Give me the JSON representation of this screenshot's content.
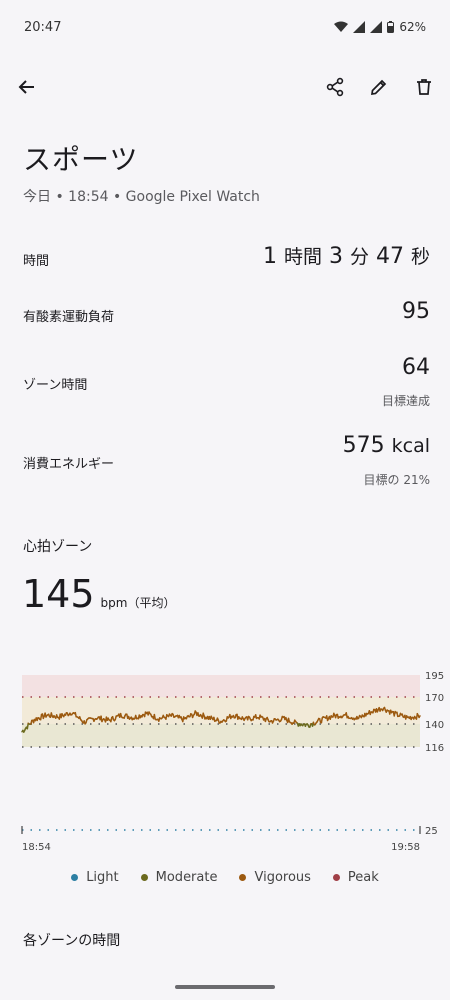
{
  "status": {
    "time": "20:47",
    "battery": "62%"
  },
  "workout": {
    "title": "スポーツ",
    "subtitle": "今日 • 18:54 • Google Pixel Watch"
  },
  "metrics": {
    "duration": {
      "label": "時間",
      "h_num": "1",
      "h_unit": "時間",
      "m_num": "3",
      "m_unit": "分",
      "s_num": "47",
      "s_unit": "秒"
    },
    "cardio_load": {
      "label": "有酸素運動負荷",
      "value": "95"
    },
    "zone_time": {
      "label": "ゾーン時間",
      "value": "64",
      "sub": "目標達成"
    },
    "energy": {
      "label": "消費エネルギー",
      "value": "575",
      "unit": "kcal",
      "sub": "目標の 21%"
    }
  },
  "heart_zones": {
    "title": "心拍ゾーン",
    "avg_value": "145",
    "avg_unit": "bpm（平均）"
  },
  "chart_data": {
    "type": "line",
    "y_ticks": [
      "195",
      "170",
      "140",
      "116",
      "25"
    ],
    "x_labels": [
      "18:54",
      "19:58"
    ],
    "ylim": [
      25,
      195
    ],
    "zone_bounds": {
      "peak": [
        170,
        195
      ],
      "vigorous": [
        140,
        170
      ],
      "moderate": [
        116,
        140
      ]
    },
    "series": [
      {
        "name": "",
        "x_minutes": [
          0,
          2,
          4,
          6,
          8,
          10,
          12,
          14,
          16,
          18,
          20,
          22,
          24,
          26,
          28,
          30,
          32,
          34,
          36,
          38,
          40,
          42,
          44,
          46,
          48,
          50,
          52,
          54,
          56,
          58,
          60,
          62,
          64
        ],
        "values": [
          132,
          145,
          150,
          148,
          153,
          142,
          147,
          144,
          150,
          147,
          152,
          146,
          149,
          145,
          152,
          147,
          143,
          150,
          145,
          148,
          143,
          146,
          141,
          139,
          144,
          149,
          150,
          146,
          153,
          158,
          151,
          147,
          149
        ]
      }
    ],
    "colors": {
      "light": "#2c7fa3",
      "moderate": "#6b6a1e",
      "vigorous": "#9c5a10",
      "peak": "#a03f47"
    }
  },
  "legend": [
    {
      "label": "Light",
      "color": "#2c7fa3"
    },
    {
      "label": "Moderate",
      "color": "#6b6a1e"
    },
    {
      "label": "Vigorous",
      "color": "#9c5a10"
    },
    {
      "label": "Peak",
      "color": "#a03f47"
    }
  ],
  "zones_section": {
    "title": "各ゾーンの時間"
  }
}
